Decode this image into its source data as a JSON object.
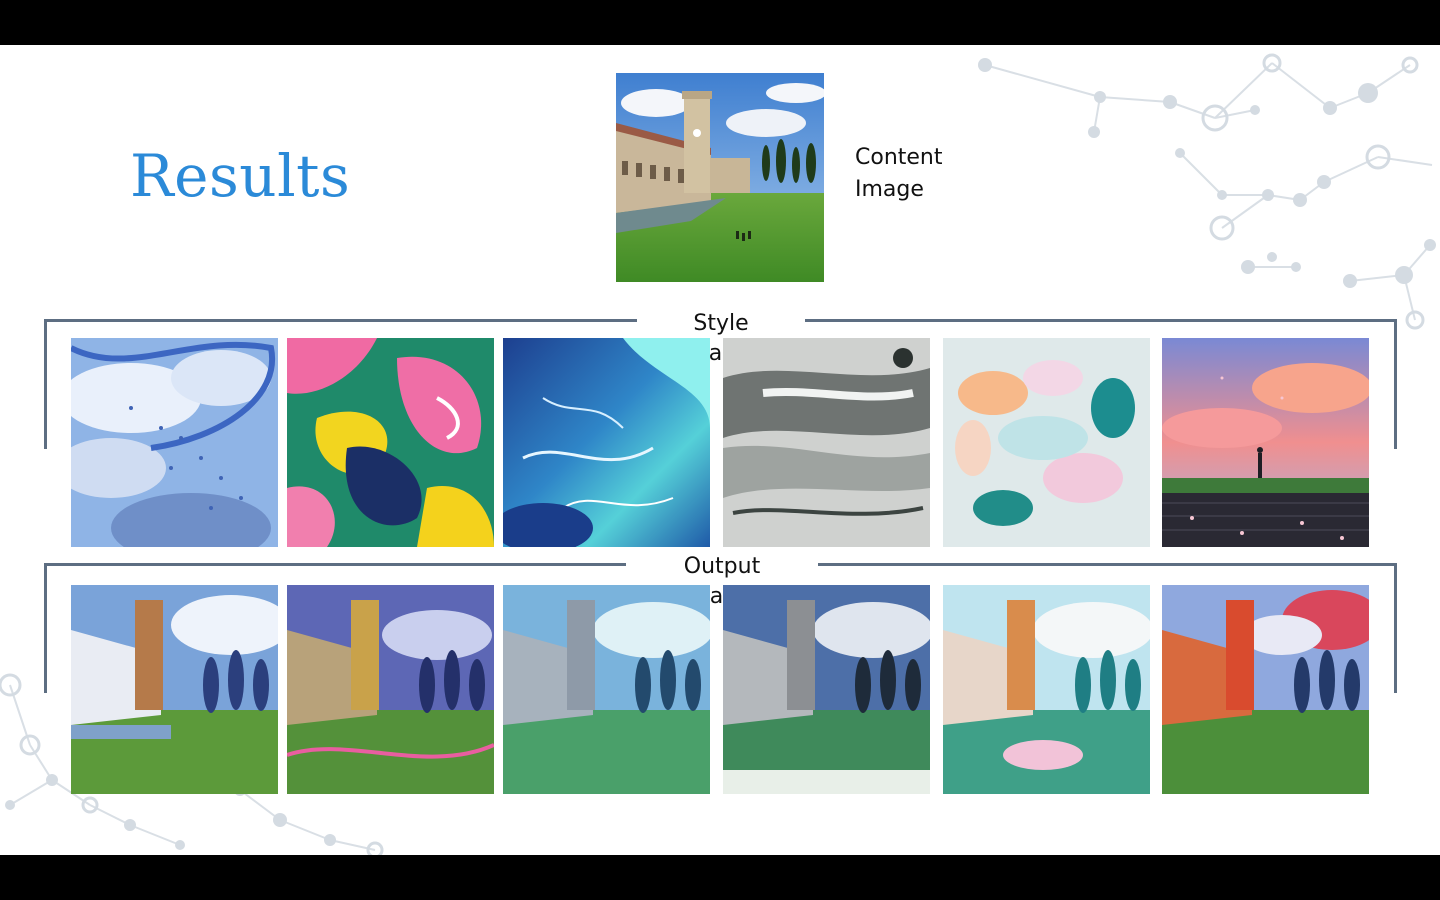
{
  "slide": {
    "title": "Results",
    "content_caption": "Content Image"
  },
  "sections": {
    "style_label": "Style Images",
    "output_label": "Output Images"
  },
  "colors": {
    "title": "#2b8ad8",
    "bracket": "#5d6e82",
    "network": "#d7dde3"
  },
  "images": {
    "content": "content-image-campus-tower",
    "style": [
      "style-image-sky-fish",
      "style-image-paint-splatter",
      "style-image-blue-fluid",
      "style-image-grey-ink",
      "style-image-pastel-abstract",
      "style-image-pink-sky-stairs"
    ],
    "output": [
      "output-image-1",
      "output-image-2",
      "output-image-3",
      "output-image-4",
      "output-image-5",
      "output-image-6"
    ]
  }
}
